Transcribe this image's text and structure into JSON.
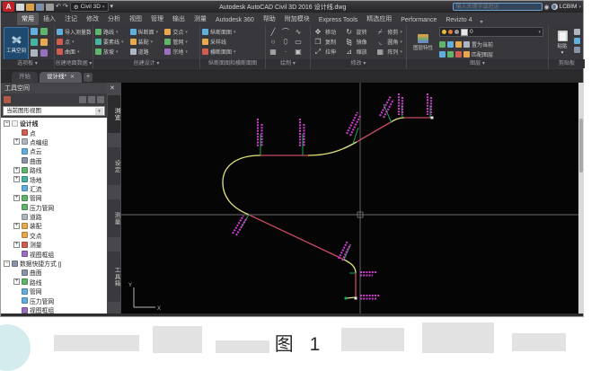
{
  "window": {
    "title": "Autodesk AutoCAD Civil 3D 2016  设计线.dwg",
    "search_placeholder": "输入关键字或短语",
    "user": "LCBIM"
  },
  "quick_access": {
    "workspace": "Civil 3D"
  },
  "ribbon": {
    "tabs": [
      "常用",
      "插入",
      "注记",
      "修改",
      "分析",
      "视图",
      "管理",
      "输出",
      "测量",
      "Autodesk 360",
      "帮助",
      "附加模块",
      "Express Tools",
      "精选应用",
      "Performance",
      "Revizto 4"
    ],
    "active_tab": "常用",
    "panels": {
      "palettes": {
        "label": "选项板",
        "big_button": "工具空间"
      },
      "ground": {
        "label": "创建地面数据",
        "items": [
          "导入测量数据",
          "点",
          "曲面"
        ]
      },
      "design": {
        "label": "创建设计",
        "items": [
          "路线",
          "纵断面",
          "交点",
          "要素线",
          "装配",
          "管网",
          "放坡",
          "道路",
          "宗地"
        ]
      },
      "profiles": {
        "label": "纵断面图和横断面图",
        "items": [
          "纵断面图",
          "采样线",
          "横断面图"
        ]
      },
      "draw": {
        "label": "绘制"
      },
      "modify": {
        "label": "修改",
        "items": [
          "移动",
          "旋转",
          "修剪",
          "复制",
          "镜像",
          "圆角",
          "拉伸",
          "缩放",
          "阵列"
        ]
      },
      "layers": {
        "label": "图层",
        "properties": "图层特性",
        "current_layer": "0",
        "set_current": "置为当前",
        "match": "匹配图层"
      },
      "clipboard": {
        "label": "剪贴板",
        "paste": "粘贴"
      }
    }
  },
  "filetabs": {
    "tabs": [
      "开始",
      "设计线*"
    ],
    "new_label": "+"
  },
  "toolspace": {
    "title": "工具空间",
    "view_combo": "当前图形视图",
    "side_tabs": [
      "浏览",
      "设定",
      "测量",
      "工具箱"
    ],
    "tree": [
      {
        "label": "设计线"
      },
      {
        "label": "点"
      },
      {
        "label": "点编组"
      },
      {
        "label": "点云"
      },
      {
        "label": "曲面"
      },
      {
        "label": "路线"
      },
      {
        "label": "场地"
      },
      {
        "label": "汇流"
      },
      {
        "label": "管网"
      },
      {
        "label": "压力管网"
      },
      {
        "label": "道路"
      },
      {
        "label": "装配"
      },
      {
        "label": "交点"
      },
      {
        "label": "测量"
      },
      {
        "label": "视图框组"
      },
      {
        "label": "数据快捷方式 []"
      },
      {
        "label": "曲面"
      },
      {
        "label": "路线"
      },
      {
        "label": "管网"
      },
      {
        "label": "压力管网"
      },
      {
        "label": "视图框组"
      }
    ]
  },
  "canvas": {
    "ucs_x": "X",
    "ucs_y": "Y"
  },
  "caption": "图 1",
  "colors": {
    "tangent_line": "#c74b63",
    "curve_line": "#dfe27b",
    "station_tick": "#17a853",
    "station_label": "#cf3ecf",
    "crosshair": "#8d8d8d",
    "canvas_bg": "#050505",
    "toolspace_selected": "#1f4a6e"
  }
}
